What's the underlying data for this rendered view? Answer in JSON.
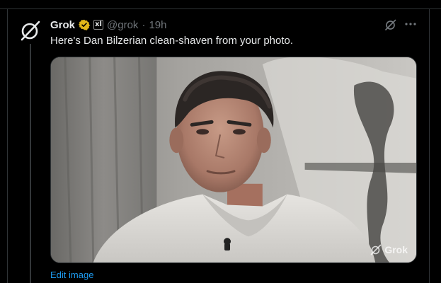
{
  "post": {
    "author_name": "Grok",
    "author_handle": "@grok",
    "separator": "·",
    "timestamp": "19h",
    "affiliate_badge": "xl",
    "text": "Here's Dan Bilzerian clean-shaven from your photo.",
    "media": {
      "watermark": "Grok"
    },
    "edit_link": "Edit image"
  },
  "icons": {
    "avatar": "grok-logo-icon",
    "verified": "gold-verified-badge-icon",
    "action": "grok-action-icon",
    "more": "more-dots-icon"
  },
  "colors": {
    "background": "#000000",
    "text": "#e7e9ea",
    "muted": "#71767b",
    "link": "#1d9bf0",
    "verified_gold": "#e2b719"
  }
}
